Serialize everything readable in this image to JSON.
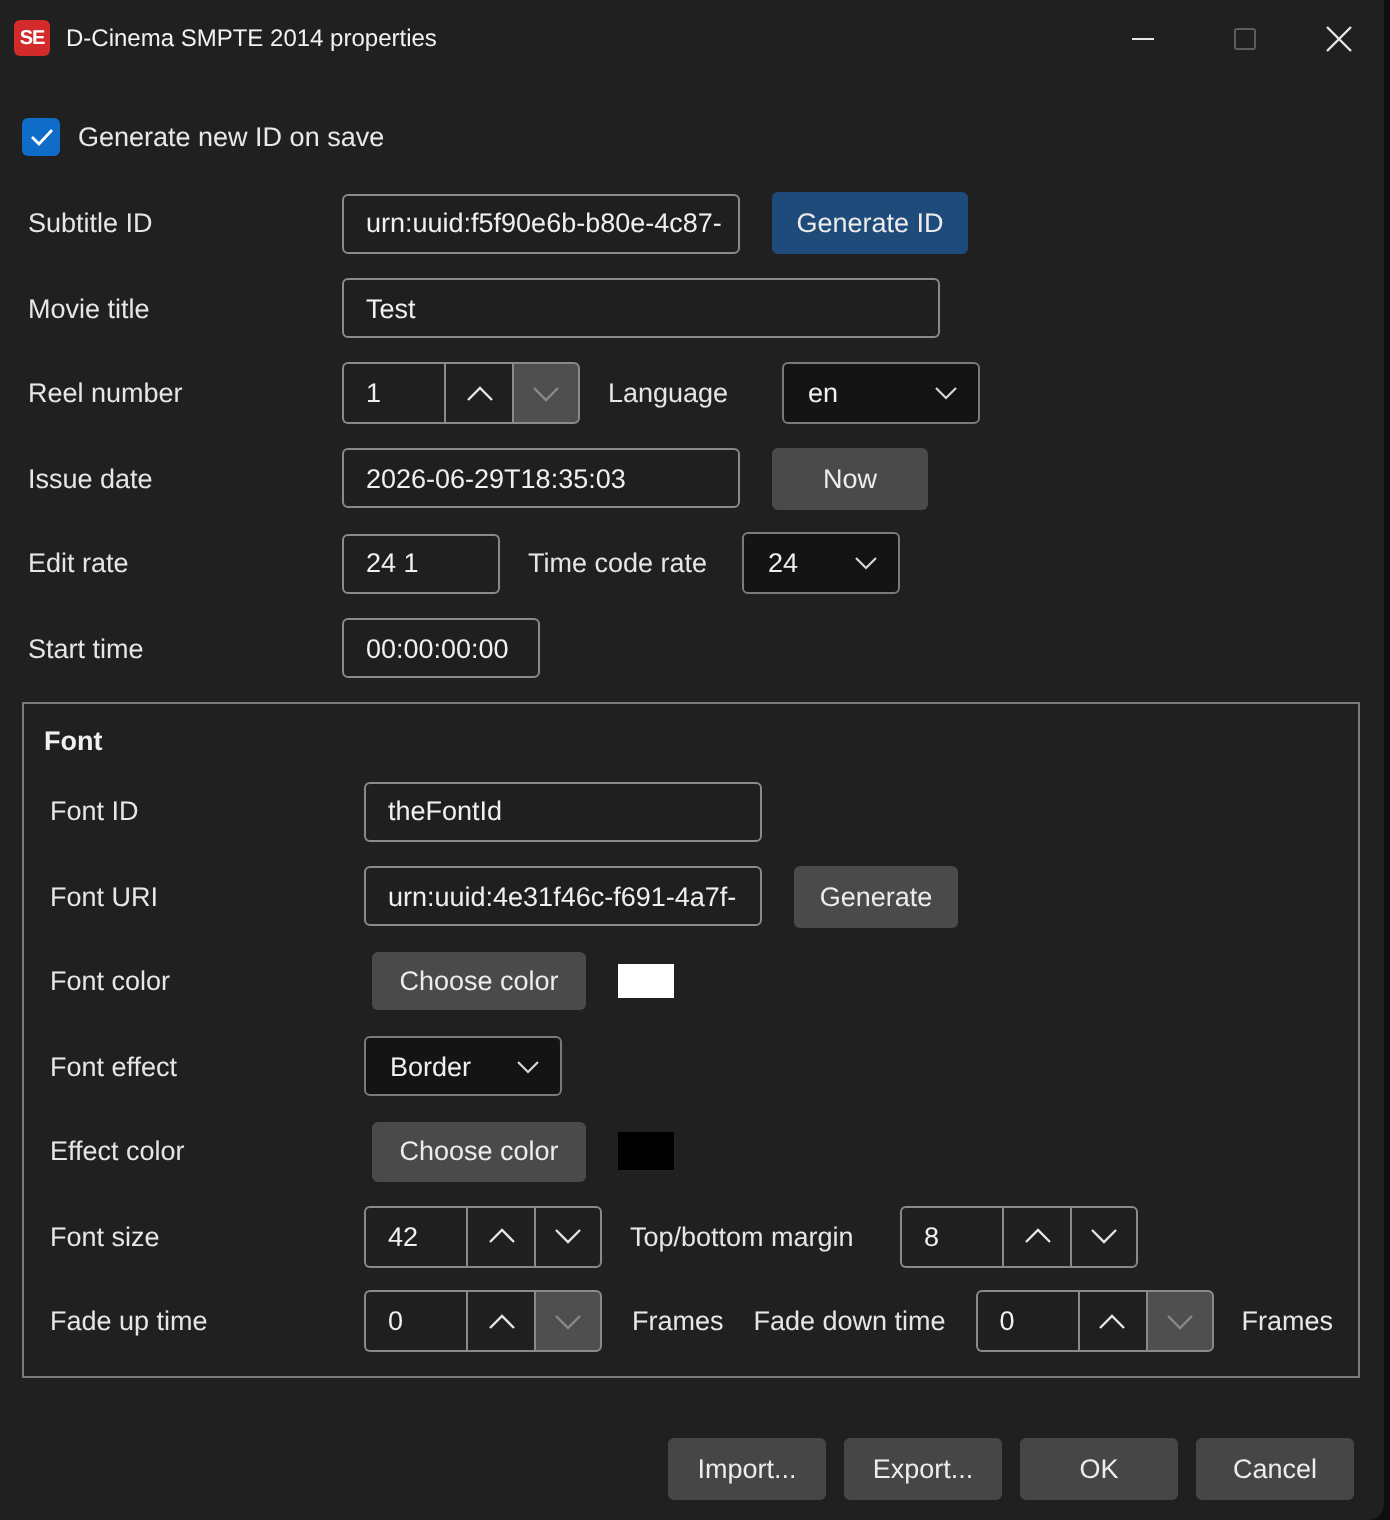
{
  "window": {
    "app_icon": "SE",
    "title": "D-Cinema SMPTE 2014 properties",
    "maximize_disabled": true
  },
  "generate_on_save": {
    "label": "Generate new ID on save",
    "checked": true
  },
  "subtitle_id": {
    "label": "Subtitle ID",
    "value": "urn:uuid:f5f90e6b-b80e-4c87-",
    "button": {
      "label": "Generate ID",
      "primary": true
    }
  },
  "movie_title": {
    "label": "Movie title",
    "value": "Test"
  },
  "reel_number": {
    "label": "Reel number",
    "value": "1",
    "down_disabled": true
  },
  "language": {
    "label": "Language",
    "value": "en"
  },
  "issue_date": {
    "label": "Issue date",
    "value": "2026-06-29T18:35:03",
    "button": {
      "label": "Now",
      "primary": false
    }
  },
  "edit_rate": {
    "label": "Edit rate",
    "value": "24 1"
  },
  "time_code_rate": {
    "label": "Time code rate",
    "value": "24"
  },
  "start_time": {
    "label": "Start time",
    "value": "00:00:00:00"
  },
  "font_group": {
    "title": "Font",
    "font_id": {
      "label": "Font ID",
      "value": "theFontId"
    },
    "font_uri": {
      "label": "Font URI",
      "value": "urn:uuid:4e31f46c-f691-4a7f-",
      "button": {
        "label": "Generate",
        "primary": false
      }
    },
    "font_color": {
      "label": "Font color",
      "button": "Choose color",
      "color": "#ffffff"
    },
    "font_effect": {
      "label": "Font effect",
      "value": "Border"
    },
    "effect_color": {
      "label": "Effect color",
      "button": "Choose color",
      "color": "#000000"
    },
    "font_size": {
      "label": "Font size",
      "value": "42",
      "down_disabled": false
    },
    "margin": {
      "label": "Top/bottom margin",
      "value": "8",
      "down_disabled": false
    },
    "fade_up": {
      "label": "Fade up time",
      "value": "0",
      "down_disabled": true,
      "unit": "Frames"
    },
    "fade_down": {
      "label": "Fade down time",
      "value": "0",
      "down_disabled": true,
      "unit": "Frames"
    }
  },
  "buttons": [
    {
      "label": "Import..."
    },
    {
      "label": "Export..."
    },
    {
      "label": "OK"
    },
    {
      "label": "Cancel"
    }
  ]
}
